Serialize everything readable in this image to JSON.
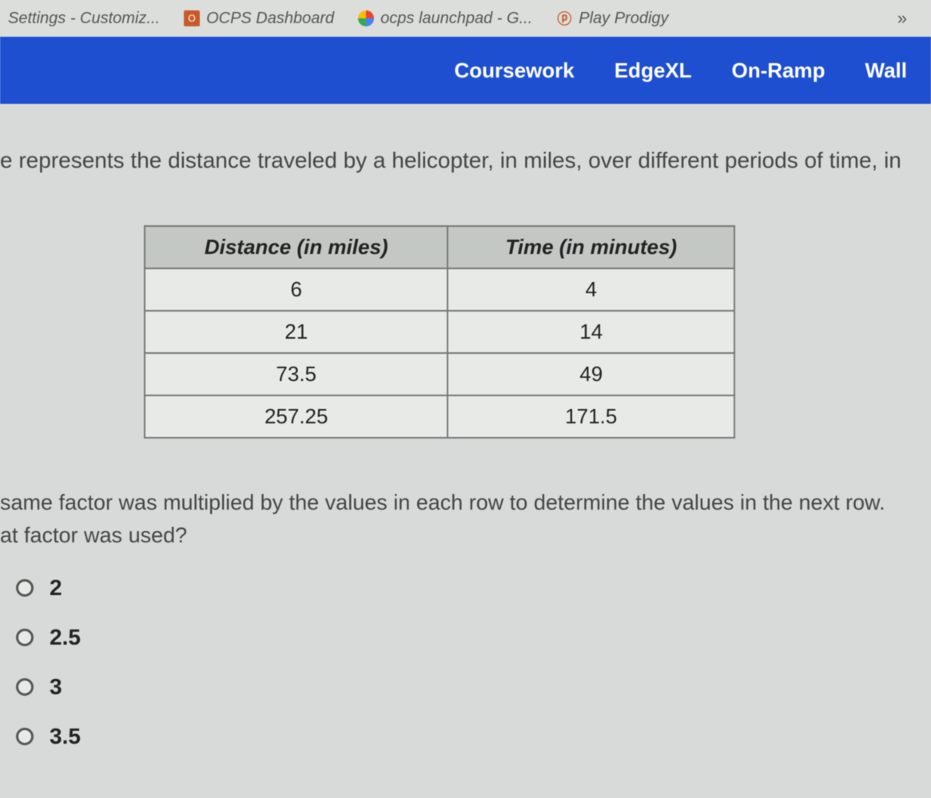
{
  "bookmarks": {
    "items": [
      {
        "label": "Settings - Customiz..."
      },
      {
        "label": "OCPS Dashboard"
      },
      {
        "label": "ocps launchpad - G..."
      },
      {
        "label": "Play Prodigy"
      }
    ],
    "more": "»"
  },
  "nav": {
    "items": [
      "Coursework",
      "EdgeXL",
      "On-Ramp",
      "Wall"
    ]
  },
  "question": {
    "intro": "e represents the distance traveled by a helicopter, in miles, over different periods of time, in",
    "table": {
      "headers": [
        "Distance (in miles)",
        "Time (in minutes)"
      ],
      "rows": [
        [
          "6",
          "4"
        ],
        [
          "21",
          "14"
        ],
        [
          "73.5",
          "49"
        ],
        [
          "257.25",
          "171.5"
        ]
      ]
    },
    "follow1": " same factor was multiplied by the values in each row to determine the values in the next row.",
    "follow2": "at factor was used?",
    "options": [
      "2",
      "2.5",
      "3",
      "3.5"
    ]
  }
}
